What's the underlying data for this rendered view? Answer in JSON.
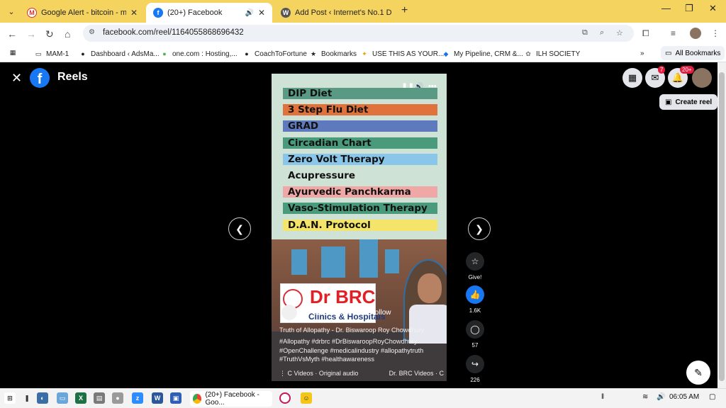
{
  "browser": {
    "tabs": [
      {
        "title": "Google Alert - bitcoin - mamaj",
        "favicon": "gmail-icon",
        "active": false
      },
      {
        "title": "(20+) Facebook",
        "favicon": "facebook-icon",
        "active": true
      },
      {
        "title": "Add Post ‹ Internet's No.1 Dom",
        "favicon": "wordpress-icon",
        "active": false
      }
    ],
    "url": "facebook.com/reel/1164055868696432",
    "bookmarks": [
      {
        "label": "MAM-1",
        "icon": "folder-icon"
      },
      {
        "label": "Dashboard ‹ AdsMa...",
        "icon": "wordpress-icon"
      },
      {
        "label": "one.com : Hosting,...",
        "icon": "onecom-icon"
      },
      {
        "label": "CoachToFortune",
        "icon": "wordpress-icon"
      },
      {
        "label": "Bookmarks",
        "icon": "star-icon"
      },
      {
        "label": "USE THIS AS YOUR...",
        "icon": "bee-icon"
      },
      {
        "label": "My Pipeline, CRM &...",
        "icon": "crm-icon"
      },
      {
        "label": "ILH SOCIETY",
        "icon": "gear-icon"
      }
    ],
    "all_bookmarks": "All Bookmarks"
  },
  "fb": {
    "section_title": "Reels",
    "messenger_badge": "7",
    "notifications_badge": "20+",
    "create_reel": "Create reel"
  },
  "reel": {
    "list_items": [
      {
        "label": "DIP Diet",
        "color": "#5a9a84"
      },
      {
        "label": "3 Step Flu Diet",
        "color": "#e0733b"
      },
      {
        "label": "GRAD",
        "color": "#5e79bd"
      },
      {
        "label": "Circadian Chart",
        "color": "#4a9a7c"
      },
      {
        "label": "Zero Volt Therapy",
        "color": "#89c6ea"
      },
      {
        "label": "Acupressure",
        "color": "transparent"
      },
      {
        "label": "Ayurvedic Panchkarma",
        "color": "#f0a8a6"
      },
      {
        "label": "Vaso-Stimulation Therapy",
        "color": "#4a9a7c"
      },
      {
        "label": "D.A.N. Protocol",
        "color": "#f4e56a"
      }
    ],
    "logo_text": "Dr BRC",
    "logo_sub": "Clinics & Hospitals",
    "creator": "Dr. BRC Videos",
    "follow": "Follow",
    "caption_title": "Truth of Allopathy - Dr. Biswaroop Roy Chowdhury",
    "hashtags": "#Allopathy #drbrc #DrBiswaroopRoyChowdhury #OpenChallenge #medicalindustry #allopathytruth #TruthVsMyth #healthawareness",
    "audio_left": "C Videos · Original audio",
    "audio_right": "Dr. BRC Videos · C"
  },
  "actions": {
    "give_label": "Give!",
    "likes": "1.6K",
    "comments": "57",
    "shares": "226"
  },
  "taskbar": {
    "active_app": "(20+) Facebook - Goo...",
    "time": "06:05 AM"
  }
}
